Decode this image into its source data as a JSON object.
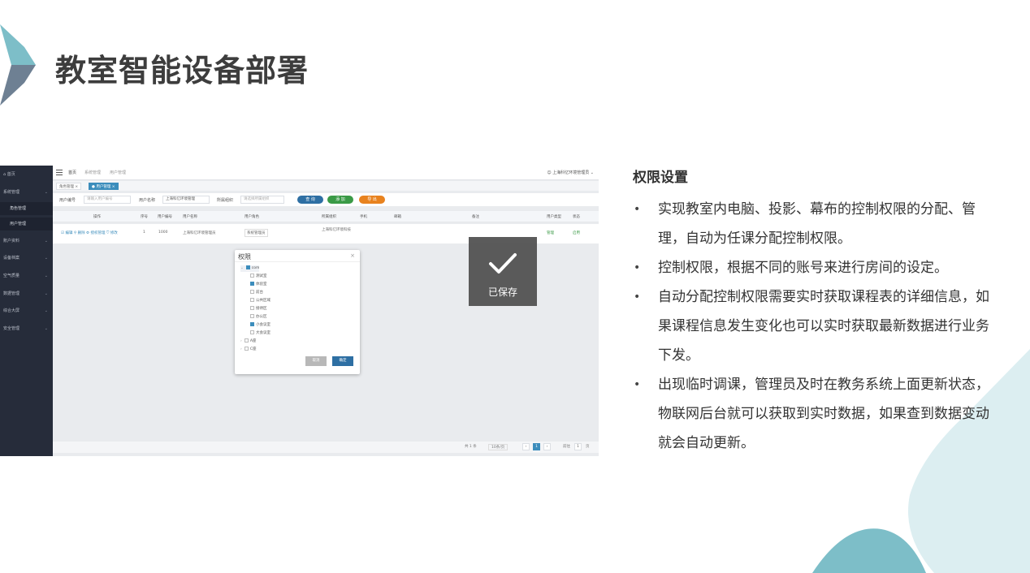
{
  "title": "教室智能设备部署",
  "colors": {
    "teal": "#7dbec8",
    "slate": "#6e8093",
    "light_teal": "#dceef1",
    "toast_bg": "#555555",
    "primary": "#3c8dbc"
  },
  "screenshot": {
    "sidebar": {
      "home": "首页",
      "menu": [
        {
          "label": "系统管理",
          "chevron": "⌄"
        },
        {
          "label": "角色管理",
          "sub": true
        },
        {
          "label": "用户管理",
          "sub": true,
          "active": true
        },
        {
          "label": "账户资料",
          "chevron": "⌄"
        },
        {
          "label": "设备档案",
          "chevron": "⌄"
        },
        {
          "label": "空气质量",
          "chevron": "⌄"
        },
        {
          "label": "数据管理",
          "chevron": "⌄"
        },
        {
          "label": "综合大屏",
          "chevron": "⌄"
        },
        {
          "label": "安全管理",
          "chevron": "⌄"
        }
      ]
    },
    "topbar": {
      "crumbs": [
        "首页",
        "系统管理",
        "用户管理"
      ],
      "user": "上海科亿环境管理员"
    },
    "tabs": [
      "角色管理 ×",
      "● 用户管理 ×"
    ],
    "filters": {
      "user_no_label": "用户编号",
      "user_no_placeholder": "请输入用户编号",
      "user_name_label": "用户名称",
      "user_name_value": "上海科亿环境管理",
      "dept_label": "所属组织",
      "dept_placeholder": "请选择所属组织",
      "btn_search": "查 询",
      "btn_add": "添 加",
      "btn_export": "导 出"
    },
    "table": {
      "headers": [
        "操作",
        "序号",
        "用户编号",
        "用户名称",
        "用户角色",
        "所属组织",
        "手机",
        "邮箱",
        "备注",
        "用户类型",
        "状态"
      ],
      "row": {
        "actions": "☑ 编辑  ⚲ 删除  ⚙ 授权管理  ⛉ 修改",
        "index": "1",
        "user_no": "1000",
        "user_name": "上海科亿环境管理员",
        "role": "系统管理员",
        "org": "上海科亿环境科技",
        "type": "管理",
        "status": "启用"
      }
    },
    "pager": {
      "total": "共 1 条",
      "per_page": "10条/页",
      "current": "1",
      "goto": "前往",
      "goto_page": "1",
      "page_unit": "页"
    },
    "dialog": {
      "title": "权限",
      "close": "×",
      "tree": [
        {
          "label": "com",
          "checked": true,
          "level": 0,
          "expand": "⌄"
        },
        {
          "label": "测试室",
          "checked": false,
          "level": 1
        },
        {
          "label": "体验室",
          "checked": true,
          "level": 1
        },
        {
          "label": "前台",
          "checked": false,
          "level": 1
        },
        {
          "label": "公共区域",
          "checked": false,
          "level": 1
        },
        {
          "label": "接待区",
          "checked": false,
          "level": 1
        },
        {
          "label": "办公区",
          "checked": false,
          "level": 1
        },
        {
          "label": "小会议室",
          "checked": true,
          "level": 1
        },
        {
          "label": "大会议室",
          "checked": false,
          "level": 1
        },
        {
          "label": "A座",
          "checked": false,
          "level": 0,
          "expand": "›"
        },
        {
          "label": "C座",
          "checked": false,
          "level": 0,
          "expand": "›"
        }
      ],
      "cancel": "取消",
      "confirm": "确定"
    },
    "toast": "已保存"
  },
  "section": {
    "title": "权限设置",
    "bullets": [
      "实现教室内电脑、投影、幕布的控制权限的分配、管理，自动为任课分配控制权限。",
      "控制权限，根据不同的账号来进行房间的设定。",
      "自动分配控制权限需要实时获取课程表的详细信息，如果课程信息发生变化也可以实时获取最新数据进行业务下发。",
      "出现临时调课，管理员及时在教务系统上面更新状态，物联网后台就可以获取到实时数据，如果查到数据变动就会自动更新。"
    ]
  }
}
